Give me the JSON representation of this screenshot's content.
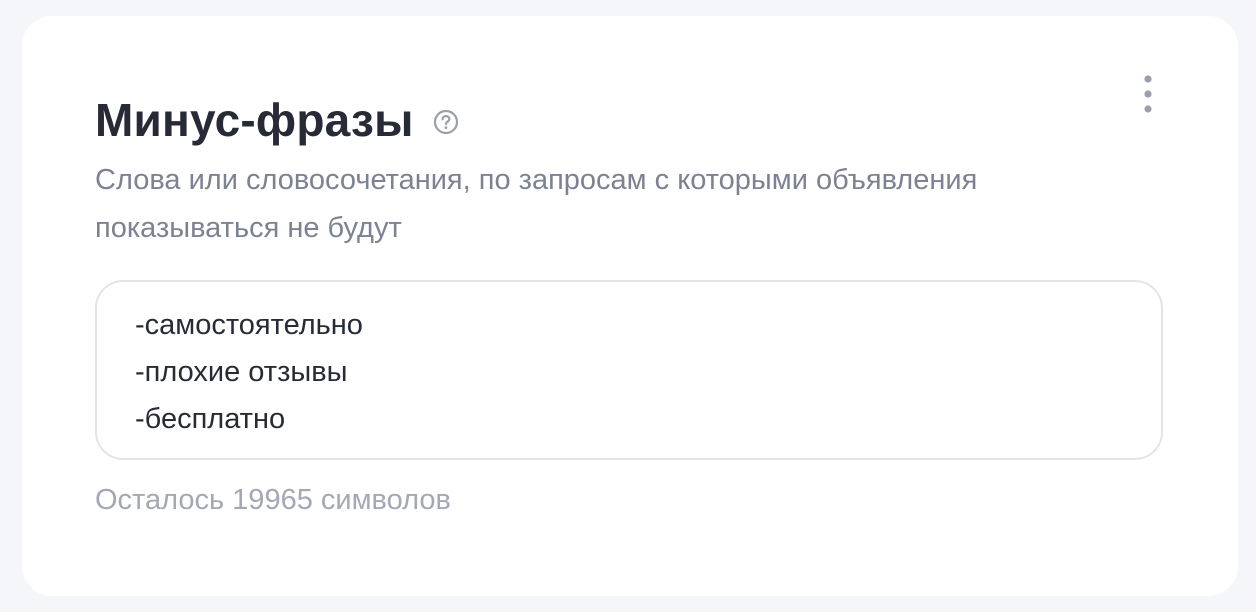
{
  "section": {
    "title": "Минус-фразы",
    "help_icon": "question-circle-icon",
    "menu_icon": "more-vertical-icon",
    "description": "Слова или словосочетания, по запросам с которыми объявления показываться не будут"
  },
  "phrases": [
    "-самостоятельно",
    "-плохие отзывы",
    "-бесплатно"
  ],
  "counter": {
    "text": "Осталось 19965 символов"
  },
  "colors": {
    "background": "#f5f6fa",
    "card": "#ffffff",
    "title": "#262b37",
    "description": "#7c8296",
    "muted": "#a3a8b6",
    "border": "#e3e4e8"
  }
}
